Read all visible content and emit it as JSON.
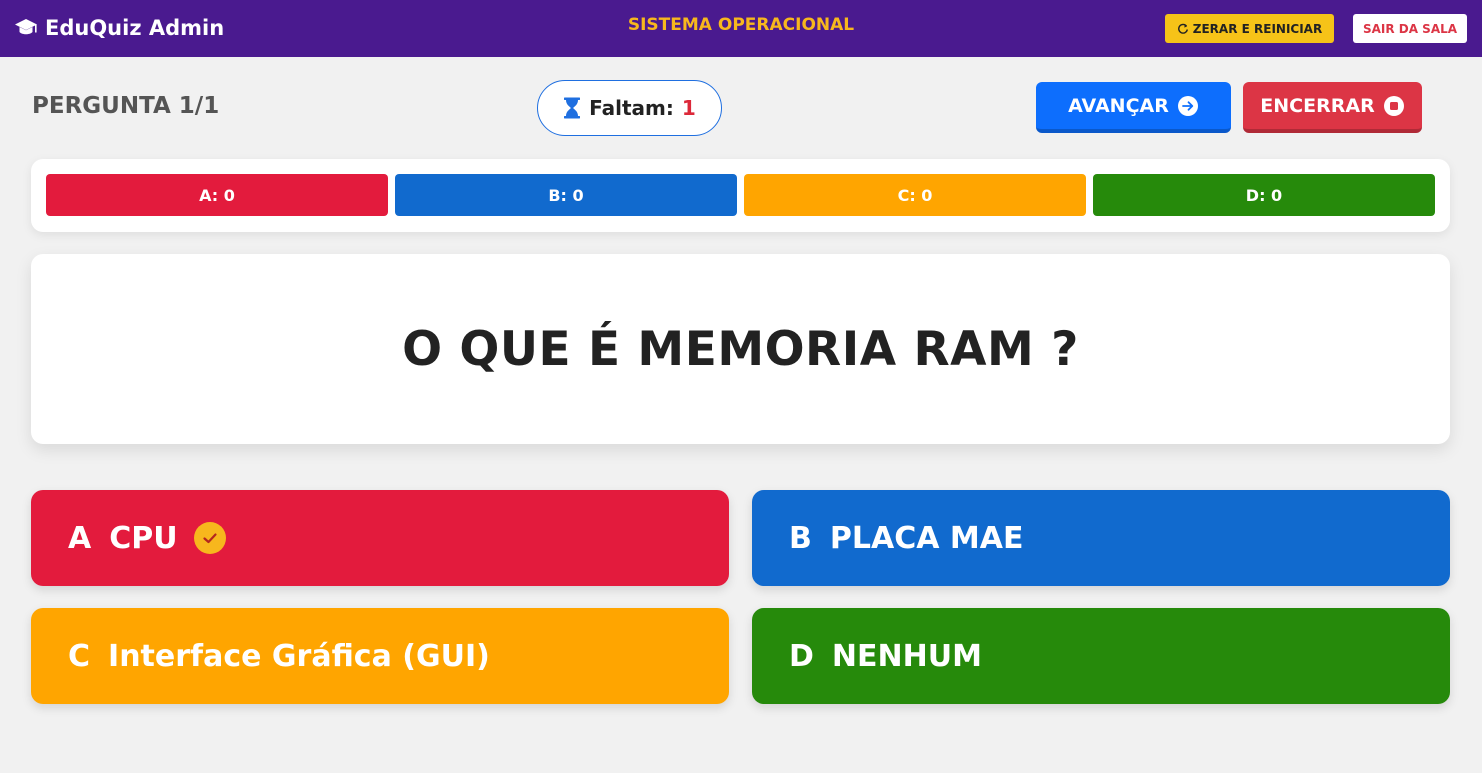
{
  "header": {
    "brand": "EduQuiz Admin",
    "room_title": "SISTEMA OPERACIONAL",
    "reset_label": "ZERAR E REINICIAR",
    "leave_label": "SAIR DA SALA",
    "icons": {
      "brand": "graduation-cap-icon",
      "reset": "refresh-icon"
    }
  },
  "controls": {
    "question_counter": "PERGUNTA 1/1",
    "timer_label": "Faltam:",
    "timer_value": "1",
    "advance_label": "AVANÇAR",
    "end_label": "ENCERRAR",
    "icons": {
      "timer": "hourglass-icon",
      "advance": "arrow-right-circle-icon",
      "end": "stop-circle-icon"
    }
  },
  "stats": [
    {
      "label": "A: 0",
      "color": "#e31b3d"
    },
    {
      "label": "B: 0",
      "color": "#116ace"
    },
    {
      "label": "C: 0",
      "color": "#ffa500"
    },
    {
      "label": "D: 0",
      "color": "#268a0b"
    }
  ],
  "question": {
    "text": "O QUE É MEMORIA RAM ?"
  },
  "answers": [
    {
      "letter": "A",
      "text": "CPU",
      "correct": true,
      "color": "#e31b3d"
    },
    {
      "letter": "B",
      "text": "PLACA MAE",
      "correct": false,
      "color": "#116ace"
    },
    {
      "letter": "C",
      "text": "Interface Gráfica (GUI)",
      "correct": false,
      "color": "#ffa500"
    },
    {
      "letter": "D",
      "text": "NENHUM",
      "correct": false,
      "color": "#268a0b"
    }
  ],
  "colors": {
    "header_bg": "#4a1a8f",
    "room_title": "#f7b71d",
    "advance": "#0d6efd",
    "end": "#dc3545",
    "reset": "#f6c318",
    "timer_value": "#dc2839"
  }
}
